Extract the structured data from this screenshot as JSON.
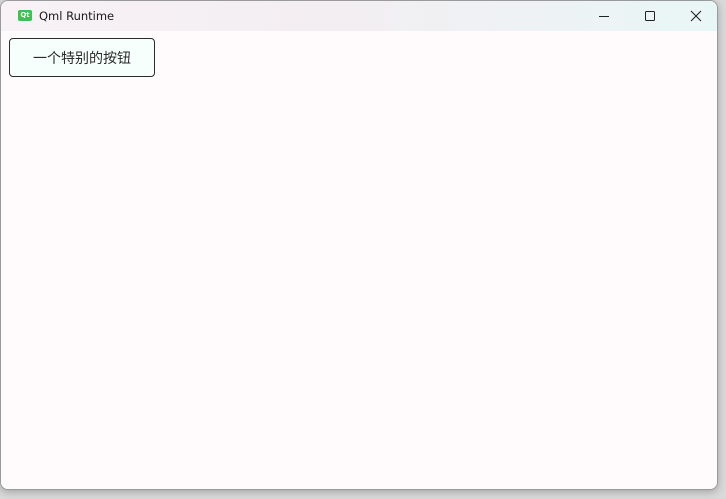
{
  "window": {
    "title": "Qml Runtime",
    "app_icon": "qt-icon"
  },
  "caption_buttons": {
    "minimize_icon": "minimize-icon",
    "maximize_icon": "maximize-icon",
    "close_icon": "close-icon"
  },
  "content": {
    "button_label": "一个特别的按钮"
  },
  "colors": {
    "button_bg": "#f6fffb",
    "button_border": "#2b2b2b",
    "window_bg": "#fffbfd",
    "app_icon": "#3fbf54"
  }
}
